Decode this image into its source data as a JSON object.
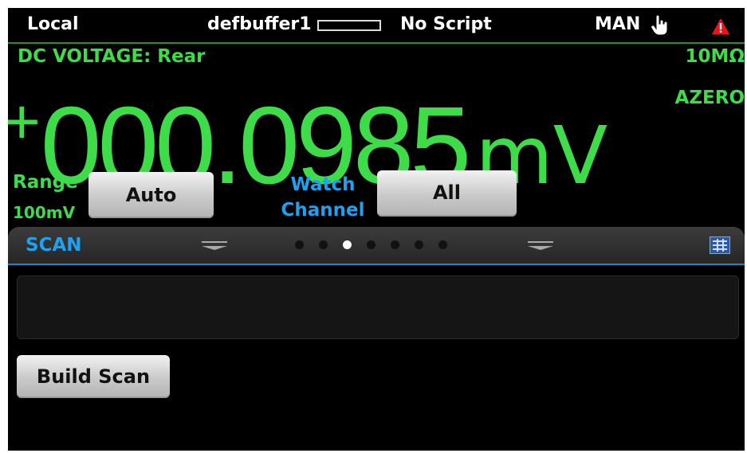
{
  "status_bar": {
    "mode": "Local",
    "buffer_name": "defbuffer1",
    "buffer_fill": 0.0,
    "script": "No Script",
    "trigger_mode": "MAN",
    "hand_icon": "hand-pointer-icon",
    "warning_icon": "warning-triangle-icon"
  },
  "measurement": {
    "function_label": "DC VOLTAGE: Rear",
    "impedance": "10MΩ",
    "sign": "+",
    "value": "000.0985",
    "unit": "mV",
    "azero": "AZERO"
  },
  "controls": {
    "range_label": "Range",
    "range_value": "100mV",
    "range_button": "Auto",
    "watch_label_line1": "Watch",
    "watch_label_line2": "Channel",
    "watch_button": "All"
  },
  "swipe": {
    "title": "SCAN",
    "page_count": 7,
    "active_page": 3,
    "grid_icon": "channel-grid-icon"
  },
  "scan": {
    "build_button": "Build Scan"
  },
  "colors": {
    "reading_green": "#3fdc4a",
    "accent_blue": "#1ea2f0",
    "background": "#000000"
  }
}
